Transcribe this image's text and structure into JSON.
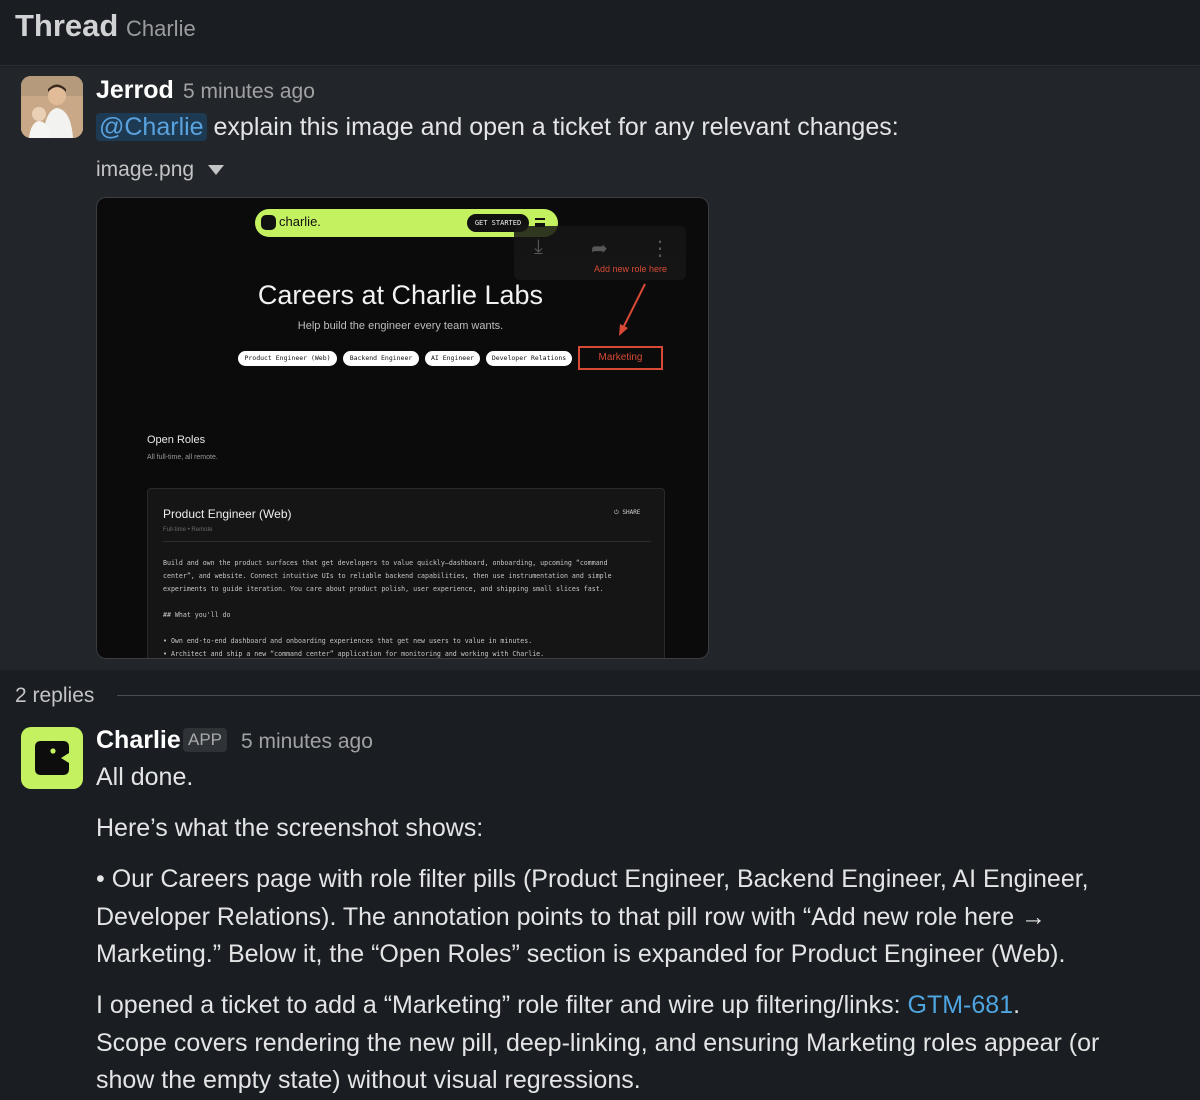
{
  "header": {
    "title": "Thread",
    "subtitle": "Charlie"
  },
  "parent_message": {
    "author": "Jerrod",
    "time": "5 minutes ago",
    "mention": "@Charlie",
    "text": " explain this image and open a ticket for any relevant changes:",
    "attachment": {
      "filename": "image.png",
      "screenshot": {
        "logo": "charlie.",
        "cta": "GET STARTED",
        "annotation": "Add new role here",
        "title": "Careers at Charlie Labs",
        "subtitle": "Help build the engineer every team wants.",
        "pills": [
          "Product Engineer (Web)",
          "Backend Engineer",
          "AI Engineer",
          "Developer Relations"
        ],
        "highlighted_pill": "Marketing",
        "open_roles": "Open Roles",
        "open_roles_sub": "All full-time, all remote.",
        "role_title": "Product Engineer (Web)",
        "role_meta": "Full-time  •  Remote",
        "share": "SHARE",
        "desc_lines": [
          "Build and own the product surfaces that get developers to value quickly—dashboard, onboarding, upcoming “command",
          "center”, and website. Connect intuitive UIs to reliable backend capabilities, then use instrumentation and simple",
          "experiments to guide iteration. You care about product polish, user experience, and shipping small slices fast.",
          "## What you'll do",
          "• Own end-to-end dashboard and onboarding experiences that get new users to value in minutes.",
          "• Architect and ship a new “command center” application for monitoring and working with Charlie."
        ]
      }
    }
  },
  "replies": {
    "count_label": "2 replies"
  },
  "reply": {
    "author": "Charlie",
    "badge": "APP",
    "time": "5 minutes ago",
    "line1": "All done.",
    "line2": "Here’s what the screenshot shows:",
    "bullet_lines": [
      "• Our Careers page with role filter pills (Product Engineer, Backend Engineer, AI Engineer,",
      "Developer Relations). The annotation points to that pill row with “Add new role here →",
      "Marketing.” Below it, the “Open Roles” section is expanded for Product Engineer (Web)."
    ],
    "ticket_prefix": "I opened a ticket to add a “Marketing” role filter and wire up filtering/links: ",
    "ticket_id": "GTM-681",
    "ticket_suffix": ".",
    "scope_lines": [
      "Scope covers rendering the new pill, deep-linking, and ensuring Marketing roles appear (or",
      "show the empty state) without visual regressions."
    ]
  }
}
